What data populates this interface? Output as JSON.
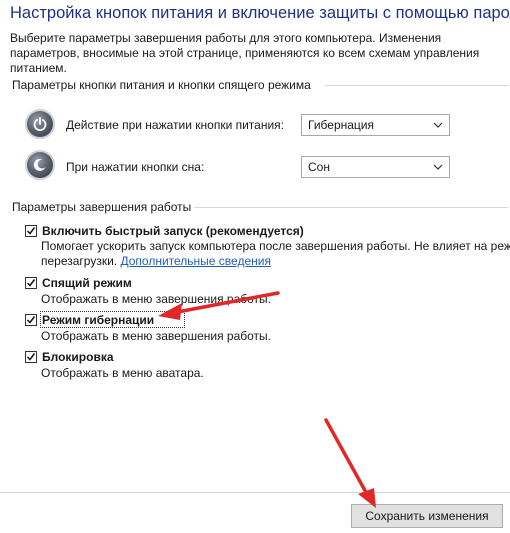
{
  "page": {
    "title": "Настройка кнопок питания и включение защиты с помощью пароля",
    "intro": "Выберите параметры завершения работы для этого компьютера. Изменения параметров, вносимые на этой странице, применяются ко всем схемам управления питанием."
  },
  "power_section": {
    "title": "Параметры кнопки питания и кнопки спящего режима",
    "rows": [
      {
        "label": "Действие при нажатии кнопки питания:",
        "value": "Гибернация",
        "icon": "power-button-icon"
      },
      {
        "label": "При нажатии кнопки сна:",
        "value": "Сон",
        "icon": "sleep-button-icon"
      }
    ]
  },
  "shutdown_section": {
    "title": "Параметры завершения работы",
    "options": [
      {
        "label": "Включить быстрый запуск (рекомендуется)",
        "checked": true,
        "desc": "Помогает ускорить запуск компьютера после завершения работы. Не влияет на режим",
        "desc2": "перезагрузки.",
        "link": "Дополнительные сведения"
      },
      {
        "label": "Спящий режим",
        "checked": true,
        "desc": "Отображать в меню завершения работы."
      },
      {
        "label": "Режим гибернации",
        "checked": true,
        "desc": "Отображать в меню завершения работы."
      },
      {
        "label": "Блокировка",
        "checked": true,
        "desc": "Отображать в меню аватара."
      }
    ]
  },
  "footer": {
    "save_label": "Сохранить изменения"
  },
  "colors": {
    "title": "#1e3287",
    "link": "#1f5fb8",
    "arrow": "#e02828"
  }
}
